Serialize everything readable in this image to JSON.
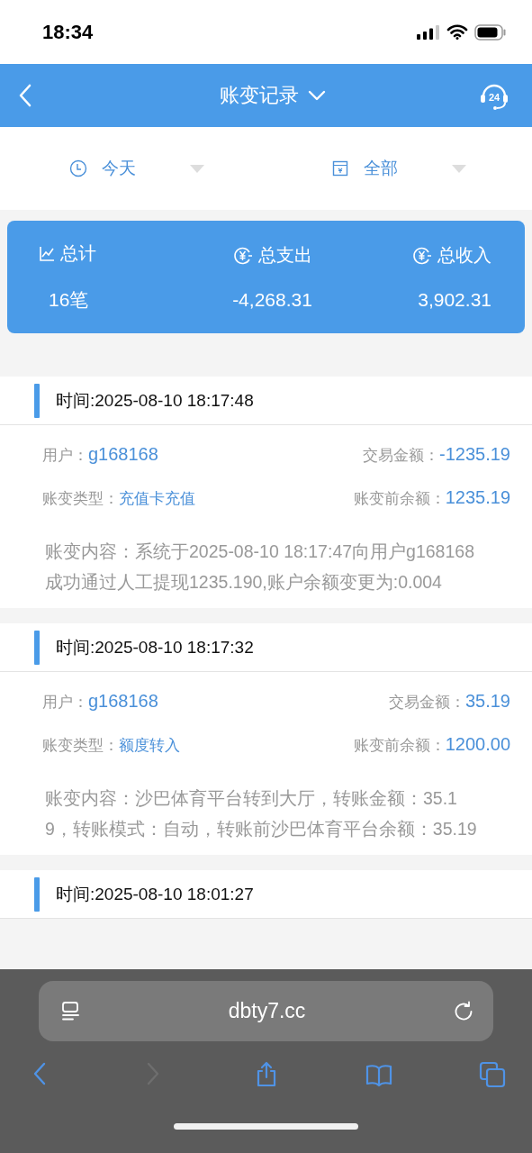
{
  "status_bar": {
    "time": "18:34"
  },
  "header": {
    "title": "账变记录",
    "service_badge": "24"
  },
  "filters": [
    {
      "kind": "date",
      "label": "今天"
    },
    {
      "kind": "type",
      "label": "全部"
    }
  ],
  "summary": [
    {
      "kind": "count",
      "label": "总计",
      "value": "16笔"
    },
    {
      "kind": "money",
      "label": "总支出",
      "value": "-4,268.31"
    },
    {
      "kind": "money",
      "label": "总收入",
      "value": "3,902.31"
    }
  ],
  "records": [
    {
      "time": "时间:2025-08-10 18:17:48",
      "user_label": "用户：",
      "user": "g168168",
      "amount_label": "交易金额：",
      "amount": "-1235.19",
      "type_label": "账变类型：",
      "type": "充值卡充值",
      "balance_label": "账变前余额：",
      "balance": "1235.19",
      "content": "账变内容：系统于2025-08-10 18:17:47向用户g168168成功通过人工提现1235.190,账户余额变更为:0.004"
    },
    {
      "time": "时间:2025-08-10 18:17:32",
      "user_label": "用户：",
      "user": "g168168",
      "amount_label": "交易金额：",
      "amount": "35.19",
      "type_label": "账变类型：",
      "type": "额度转入",
      "balance_label": "账变前余额：",
      "balance": "1200.00",
      "content": "账变内容：沙巴体育平台转到大厅，转账金额：35.19，转账模式：自动，转账前沙巴体育平台余额：35.19"
    },
    {
      "time": "时间:2025-08-10 18:01:27"
    }
  ],
  "browser": {
    "url": "dbty7.cc",
    "toolbar": [
      {
        "kind": "back",
        "disabled": false
      },
      {
        "kind": "forward",
        "disabled": true
      },
      {
        "kind": "share",
        "disabled": false
      },
      {
        "kind": "bookmarks",
        "disabled": false
      },
      {
        "kind": "tabs",
        "disabled": false
      }
    ]
  }
}
